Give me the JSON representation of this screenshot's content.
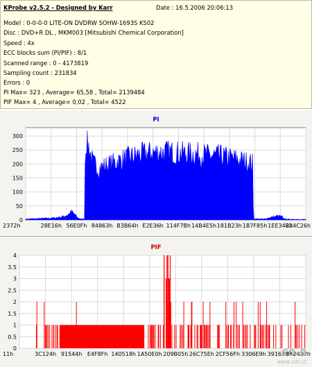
{
  "info": {
    "title": "KProbe v2.5.2 - Designed by Karr",
    "date": "Date : 16.5.2006 20:06:13",
    "lines": [
      "Model : 0-0-0-0 LITE-ON DVDRW SOHW-1693S KS02",
      "Disc : DVD+R DL , MKM003 [Mitsubishi Chemical Corporation]",
      "Speed : 4x",
      "ECC blocks sum (PI/PIF) : 8/1",
      "Scanned range : 0 - 4173819",
      "Sampling count : 231834",
      "Errors : 0",
      "PI Max= 323 , Average= 65,58 , Total= 2139484",
      "PIF Max= 4 , Average= 0,02 , Total= 4522"
    ]
  },
  "watermark": {
    "logo": "CD-R",
    "url": "www.cdr.cz"
  },
  "chart_data": [
    {
      "type": "area",
      "title": "PI",
      "color": "#0000ff",
      "ylim": [
        0,
        330
      ],
      "yticks": [
        0,
        50,
        100,
        150,
        200,
        250,
        300
      ],
      "xticks": [
        "2372h",
        "28E16h",
        "56E0Fh",
        "84863h",
        "B3B64h",
        "E2E36h",
        "114F7Bh",
        "14B4E5h",
        "181B23h",
        "1B7F85h",
        "1EE34Bh",
        "224C26h"
      ],
      "grid": true,
      "profile": [
        [
          0,
          3
        ],
        [
          0.05,
          5
        ],
        [
          0.1,
          7
        ],
        [
          0.13,
          11
        ],
        [
          0.15,
          18
        ],
        [
          0.165,
          28
        ],
        [
          0.175,
          20
        ],
        [
          0.185,
          8
        ],
        [
          0.195,
          4
        ],
        [
          0.205,
          3
        ],
        [
          0.211,
          4
        ],
        [
          0.213,
          300
        ],
        [
          0.225,
          285
        ],
        [
          0.24,
          220
        ],
        [
          0.26,
          200
        ],
        [
          0.3,
          215
        ],
        [
          0.35,
          235
        ],
        [
          0.4,
          250
        ],
        [
          0.45,
          260
        ],
        [
          0.5,
          262
        ],
        [
          0.55,
          258
        ],
        [
          0.6,
          255
        ],
        [
          0.65,
          250
        ],
        [
          0.7,
          245
        ],
        [
          0.75,
          235
        ],
        [
          0.79,
          225
        ],
        [
          0.81,
          220
        ],
        [
          0.813,
          4
        ],
        [
          0.85,
          3
        ],
        [
          0.87,
          8
        ],
        [
          0.9,
          14
        ],
        [
          0.915,
          12
        ],
        [
          0.92,
          4
        ],
        [
          0.95,
          2
        ],
        [
          1,
          2
        ]
      ]
    },
    {
      "type": "bar",
      "title": "PIF",
      "color": "#ff0000",
      "ylim": [
        0,
        4
      ],
      "yticks": [
        0,
        0.5,
        1,
        1.5,
        2,
        2.5,
        3,
        3.5,
        4
      ],
      "xticks": [
        "11h",
        "3C124h",
        "91544h",
        "E4F8Fh",
        "140518h",
        "1A50E0h",
        "209B05h",
        "26C75Eh",
        "2CF56Fh",
        "3306E9h",
        "391638h",
        "3F2462h"
      ],
      "grid": true,
      "dense_block": {
        "from": 0.14,
        "to": 0.435,
        "value": 1
      },
      "cluster": {
        "from": 0.505,
        "to": 0.53,
        "max": 4
      }
    }
  ]
}
